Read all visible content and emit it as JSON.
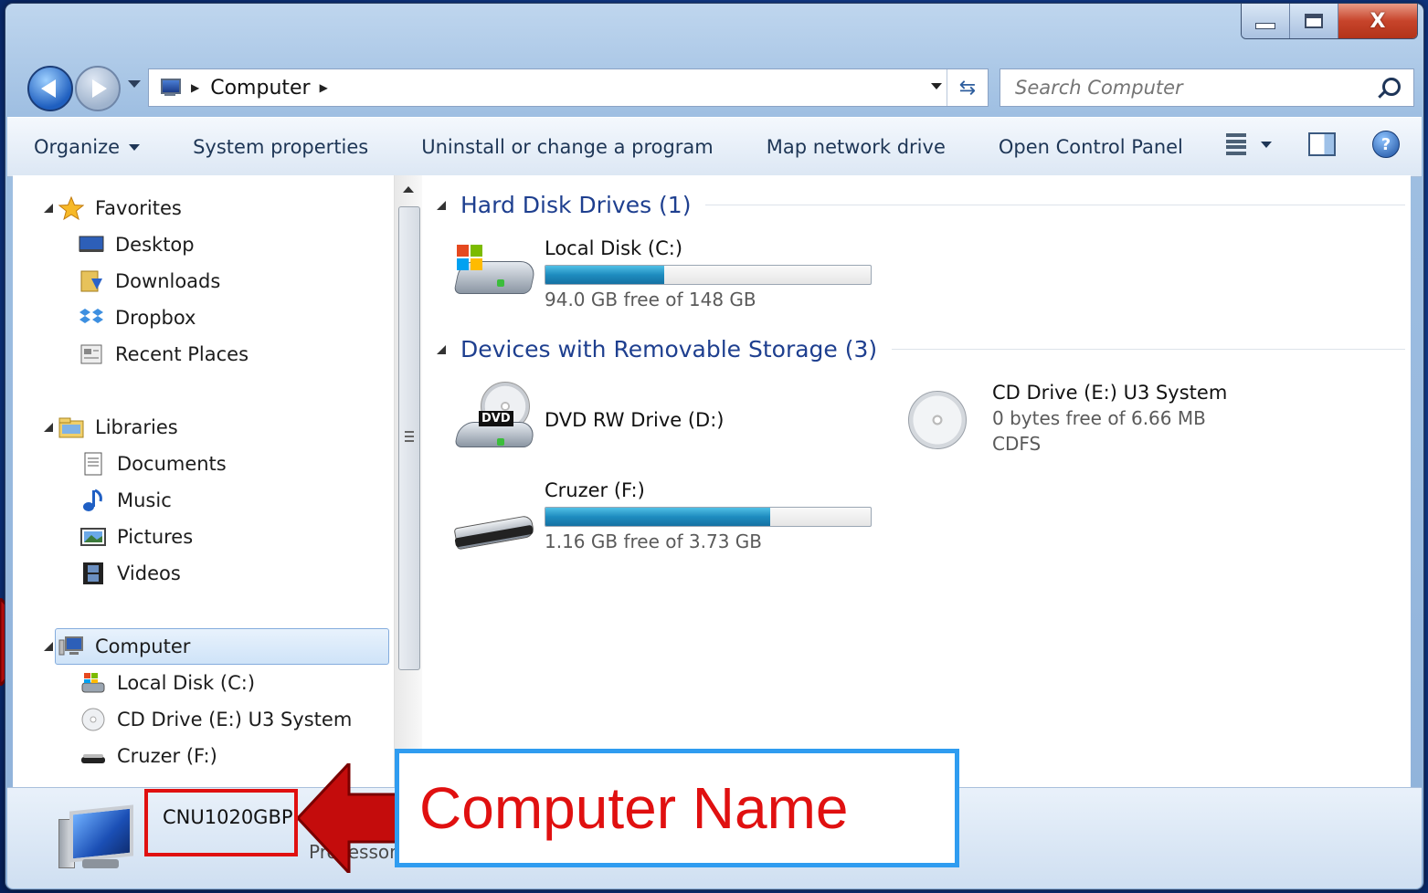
{
  "window": {
    "controls": {
      "minimize_icon": "minimize-icon",
      "maximize_icon": "maximize-icon",
      "close_label": "X"
    }
  },
  "address_bar": {
    "breadcrumb": [
      "Computer"
    ],
    "search_placeholder": "Search Computer"
  },
  "command_bar": {
    "items": [
      "Organize",
      "System properties",
      "Uninstall or change a program",
      "Map network drive",
      "Open Control Panel"
    ]
  },
  "nav_pane": {
    "favorites": {
      "label": "Favorites",
      "items": [
        "Desktop",
        "Downloads",
        "Dropbox",
        "Recent Places"
      ]
    },
    "libraries": {
      "label": "Libraries",
      "items": [
        "Documents",
        "Music",
        "Pictures",
        "Videos"
      ]
    },
    "computer": {
      "label": "Computer",
      "items": [
        "Local Disk (C:)",
        "CD Drive (E:) U3 System",
        "Cruzer (F:)"
      ]
    }
  },
  "content": {
    "hard_disk_group": "Hard Disk Drives (1)",
    "removable_group": "Devices with Removable Storage (3)",
    "local_disk": {
      "name": "Local Disk (C:)",
      "free": "94.0 GB free of 148 GB",
      "used_fraction": 0.365
    },
    "dvd": {
      "name": "DVD RW Drive (D:)",
      "badge": "DVD"
    },
    "cd": {
      "name": "CD Drive (E:) U3 System",
      "free": "0 bytes free of 6.66 MB",
      "fs": "CDFS"
    },
    "cruzer": {
      "name": "Cruzer (F:)",
      "free": "1.16 GB free of 3.73 GB",
      "used_fraction": 0.69
    }
  },
  "details": {
    "computer_name": "CNU1020GBP",
    "partial_label": "Processor"
  },
  "annotation": {
    "callout": "Computer Name"
  },
  "colors": {
    "accent": "#1e3f8f",
    "callout_border": "#2f9cf0",
    "annotation_red": "#e01010",
    "bar_fill": "#1e8cbf"
  }
}
